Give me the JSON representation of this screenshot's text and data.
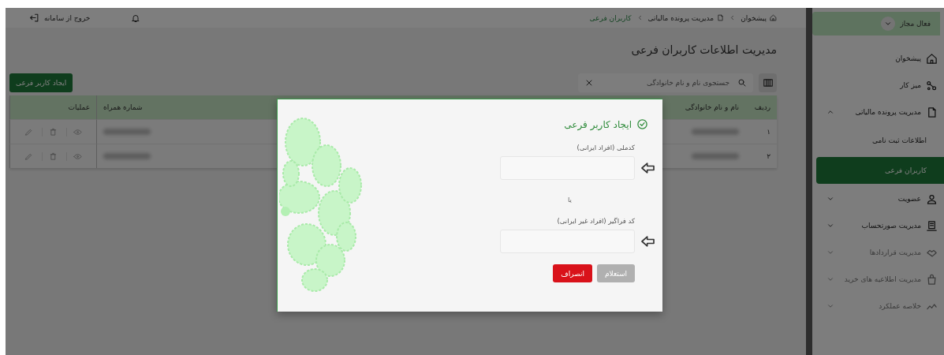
{
  "topbar": {
    "logout": "خروج از سامانه",
    "breadcrumb": [
      "پیشخوان",
      "مدیریت پرونده مالیاتی",
      "کاربران فرعی"
    ]
  },
  "page": {
    "title": "مدیریت اطلاعات کاربران فرعی",
    "search": {
      "placeholder": "جستجوی نام و نام خانوادگی"
    },
    "create_button": "ایجاد کاربر فرعی"
  },
  "table": {
    "columns": [
      "ردیف",
      "نام و نام خانوادگی",
      "شماره همراه",
      "عملیات"
    ],
    "rows": [
      {
        "index": "۱"
      },
      {
        "index": "۲"
      }
    ]
  },
  "sidebar": {
    "status": "فعال مجاز",
    "items": [
      {
        "label": "پیشخوان",
        "kind": "link",
        "disabled": false
      },
      {
        "label": "میز کار",
        "kind": "link",
        "disabled": false
      },
      {
        "label": "مدیریت پرونده مالیاتی",
        "kind": "group",
        "expanded": true,
        "disabled": false,
        "children": [
          {
            "label": "اطلاعات ثبت نامی",
            "selected": false
          },
          {
            "label": "کاربران فرعی",
            "selected": true
          }
        ]
      },
      {
        "label": "عضویت",
        "kind": "group",
        "expanded": false,
        "disabled": false
      },
      {
        "label": "مدیریت صورتحساب",
        "kind": "group",
        "expanded": false,
        "disabled": false
      },
      {
        "label": "مدیریت قراردادها",
        "kind": "group",
        "expanded": false,
        "disabled": true
      },
      {
        "label": "مدیریت اطلاعیه های خرید",
        "kind": "group",
        "expanded": false,
        "disabled": true
      },
      {
        "label": "خلاصه عملکرد",
        "kind": "group",
        "expanded": false,
        "disabled": true
      }
    ]
  },
  "dialog": {
    "title": "ایجاد کاربر فرعی",
    "fields": [
      {
        "label": "کدملی (افراد ایرانی)"
      },
      {
        "label": "کد فراگیر (افراد غیر ایرانی)"
      }
    ],
    "separator": "یا",
    "buttons": [
      {
        "label": "استعلام",
        "disabled": true,
        "kind": "primary"
      },
      {
        "label": "انصراف",
        "disabled": false,
        "kind": "danger"
      }
    ]
  }
}
